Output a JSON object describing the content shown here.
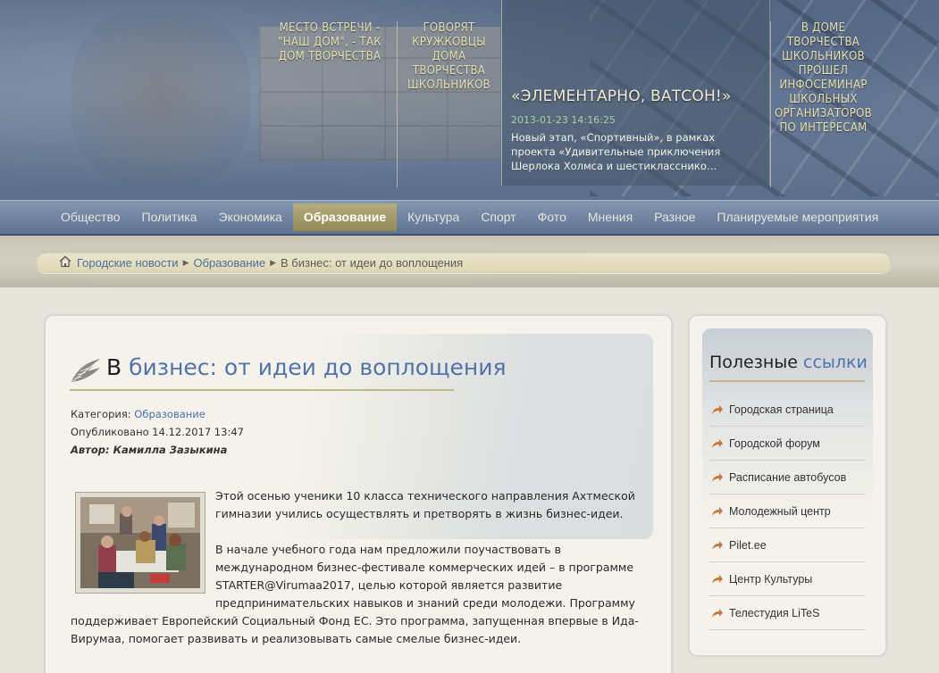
{
  "header": {
    "col1": "МЕСТО ВСТРЕЧИ - \"НАШ ДОМ\", - ТАК ДОМ ТВОРЧЕСТВА",
    "col2": "ГОВОРЯТ КРУЖКОВЦЫ ДОМА ТВОРЧЕСТВА ШКОЛЬНИКОВ",
    "feature": {
      "title": "«ЭЛЕМЕНТАРНО, ВАТСОН!»",
      "date": "2013-01-23 14:16:25",
      "text": "Новый этап, «Спортивный», в рамках проекта «Удивительные приключения Шерлока Холмса и шестикласснико…"
    },
    "col4": "В ДОМЕ ТВОРЧЕСТВА ШКОЛЬНИКОВ ПРОШЕЛ ИНФОСЕМИНАР ШКОЛЬНЫХ ОРГАНИЗАТОРОВ ПО ИНТЕРЕСАМ"
  },
  "nav": {
    "items": [
      {
        "label": "Общество"
      },
      {
        "label": "Политика"
      },
      {
        "label": "Экономика"
      },
      {
        "label": "Образование",
        "active": true
      },
      {
        "label": "Культура"
      },
      {
        "label": "Спорт"
      },
      {
        "label": "Фото"
      },
      {
        "label": "Мнения"
      },
      {
        "label": "Разное"
      },
      {
        "label": "Планируемые мероприятия"
      }
    ]
  },
  "breadcrumb": {
    "home": "Городские новости",
    "section": "Образование",
    "current": "В бизнес: от идеи до воплощения"
  },
  "article": {
    "title_prefix": "В",
    "title_highlight": "бизнес: от идеи до воплощения",
    "category_label": "Категория:",
    "category": "Образование",
    "published": "Опубликовано 14.12.2017 13:47",
    "author": "Автор: Камилла Зазыкина",
    "p1": "Этой осенью ученики 10 класса технического направления Ахтмеской гимназии учились осуществлять и претворять в жизнь бизнес-идеи.",
    "p2": "В начале учебного года нам предложили поучаствовать в международном бизнес-фестивале коммерческих идей – в программе STARTER@Virumaa2017, целью которой является развитие предпринимательских навыков и знаний среди молодежи. Программу поддерживает Европейский Социальный Фонд ЕС. Это программа, запущенная впервые в Ида-Вирумаа, помогает развивать и реализовывать самые смелые бизнес-идеи."
  },
  "sidebar": {
    "title_prefix": "Полезные",
    "title_highlight": "ссылки",
    "links": [
      {
        "label": "Городская страница"
      },
      {
        "label": "Городской форум"
      },
      {
        "label": "Расписание автобусов"
      },
      {
        "label": "Молодежный центр"
      },
      {
        "label": "Pilet.ee"
      },
      {
        "label": "Центр Культуры"
      },
      {
        "label": "Телестудия LiTeS"
      }
    ]
  },
  "colors": {
    "accent_link": "#4d6f9b",
    "nav_active": "#a39a68",
    "rule_gold": "#c4b88b"
  }
}
